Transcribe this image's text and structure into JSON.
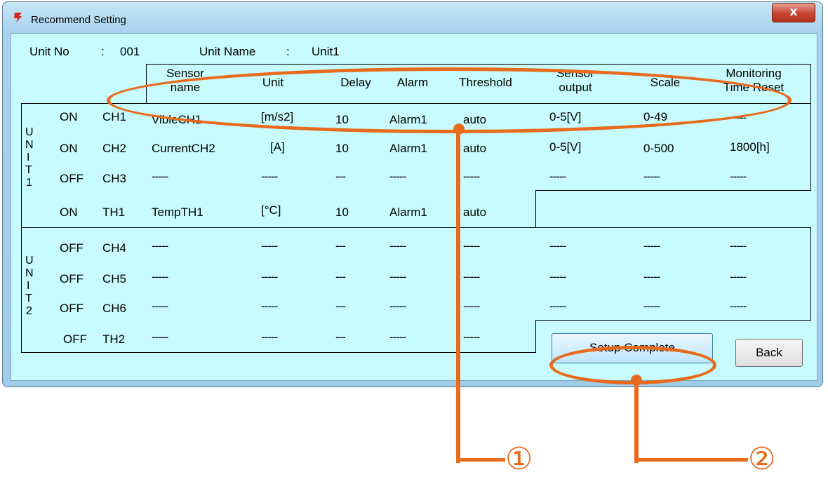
{
  "window": {
    "title": "Recommend Setting",
    "close_symbol": "x"
  },
  "info": {
    "unit_no_label": "Unit No",
    "unit_no_sep": ":",
    "unit_no_value": "001",
    "unit_name_label": "Unit Name",
    "unit_name_sep": ":",
    "unit_name_value": "Unit1"
  },
  "headers": {
    "sensor_name_1": "Sensor",
    "sensor_name_2": "name",
    "unit": "Unit",
    "delay": "Delay",
    "alarm": "Alarm",
    "threshold": "Threshold",
    "sensor_output_1": "Sensor",
    "sensor_output_2": "output",
    "scale": "Scale",
    "monitoring_1": "Monitoring",
    "monitoring_2": "Time Reset"
  },
  "unit_labels": {
    "unit1": [
      "U",
      "N",
      "I",
      "T",
      "1"
    ],
    "unit2": [
      "U",
      "N",
      "I",
      "T",
      "2"
    ]
  },
  "rows": [
    {
      "state": "ON",
      "ch": "CH1",
      "name": "VibleCH1",
      "unit": "[m/s2]",
      "delay": "10",
      "alarm": "Alarm1",
      "threshold": "auto",
      "output": "0-5[V]",
      "scale": "0-49",
      "reset": "-----"
    },
    {
      "state": "ON",
      "ch": "CH2",
      "name": "CurrentCH2",
      "unit": "[A]",
      "delay": "10",
      "alarm": "Alarm1",
      "threshold": "auto",
      "output": "0-5[V]",
      "scale": "0-500",
      "reset": "1800[h]"
    },
    {
      "state": "OFF",
      "ch": "CH3",
      "name": "-----",
      "unit": "-----",
      "delay": "---",
      "alarm": "-----",
      "threshold": "-----",
      "output": "-----",
      "scale": "-----",
      "reset": "-----"
    },
    {
      "state": "ON",
      "ch": "TH1",
      "name": "TempTH1",
      "unit": "[°C]",
      "delay": "10",
      "alarm": "Alarm1",
      "threshold": "auto"
    },
    {
      "state": "OFF",
      "ch": "CH4",
      "name": "-----",
      "unit": "-----",
      "delay": "---",
      "alarm": "-----",
      "threshold": "-----",
      "output": "-----",
      "scale": "-----",
      "reset": "-----"
    },
    {
      "state": "OFF",
      "ch": "CH5",
      "name": "-----",
      "unit": "-----",
      "delay": "---",
      "alarm": "-----",
      "threshold": "-----",
      "output": "-----",
      "scale": "-----",
      "reset": "-----"
    },
    {
      "state": "OFF",
      "ch": "CH6",
      "name": "-----",
      "unit": "-----",
      "delay": "---",
      "alarm": "-----",
      "threshold": "-----",
      "output": "-----",
      "scale": "-----",
      "reset": "-----"
    },
    {
      "state": "OFF",
      "ch": "TH2",
      "name": "-----",
      "unit": "-----",
      "delay": "---",
      "alarm": "-----",
      "threshold": "-----"
    }
  ],
  "buttons": {
    "setup_complete": "Setup Complete",
    "back": "Back"
  },
  "annotations": {
    "callout_1": "①",
    "callout_2": "②"
  },
  "colors": {
    "background": "#c8fbfd",
    "annotation": "#e86a1c",
    "close": "#c5432f"
  }
}
